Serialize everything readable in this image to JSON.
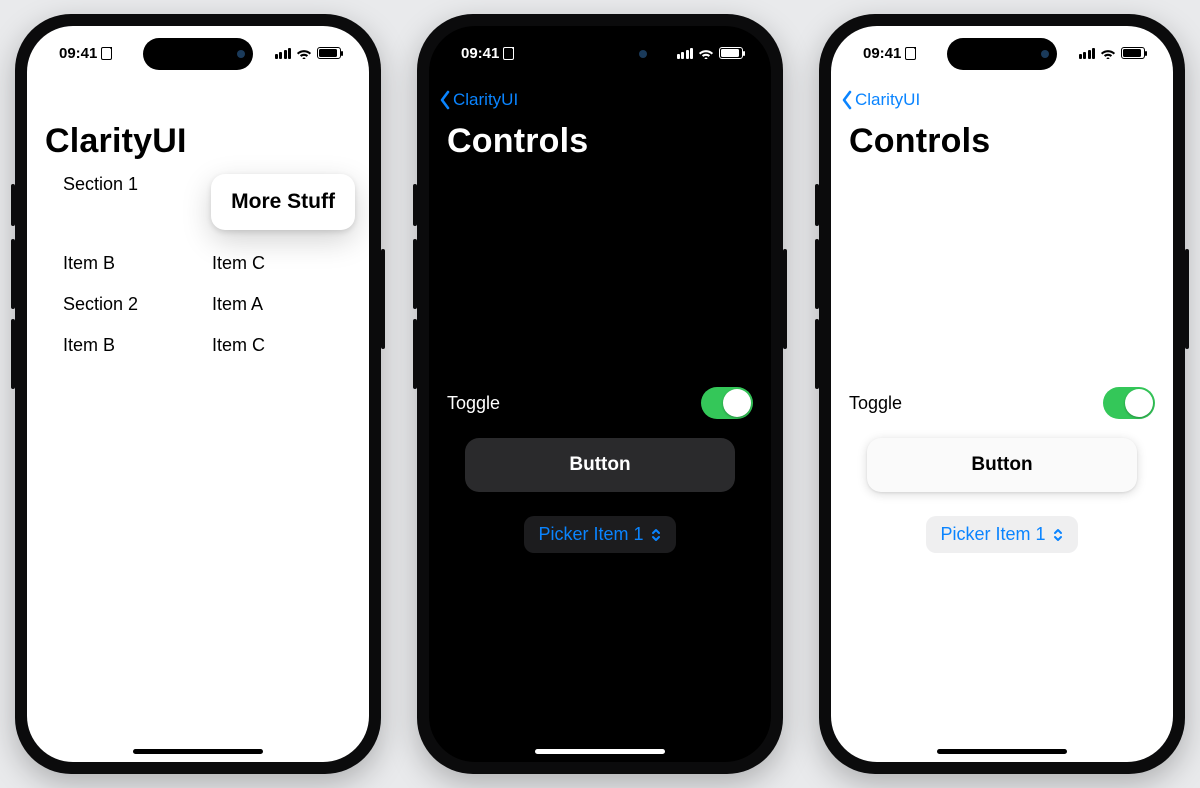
{
  "status": {
    "time": "09:41"
  },
  "phone1": {
    "title": "ClarityUI",
    "section1_label": "Section 1",
    "popover_label": "More Stuff",
    "items": {
      "r2c1": "Item B",
      "r2c2": "Item C",
      "r3c1": "Section 2",
      "r3c2": "Item A",
      "r4c1": "Item B",
      "r4c2": "Item C"
    }
  },
  "phone2": {
    "back_label": "ClarityUI",
    "title": "Controls",
    "toggle_label": "Toggle",
    "toggle_on": true,
    "button_label": "Button",
    "picker_label": "Picker Item 1"
  },
  "phone3": {
    "back_label": "ClarityUI",
    "title": "Controls",
    "toggle_label": "Toggle",
    "toggle_on": true,
    "button_label": "Button",
    "picker_label": "Picker Item 1"
  }
}
